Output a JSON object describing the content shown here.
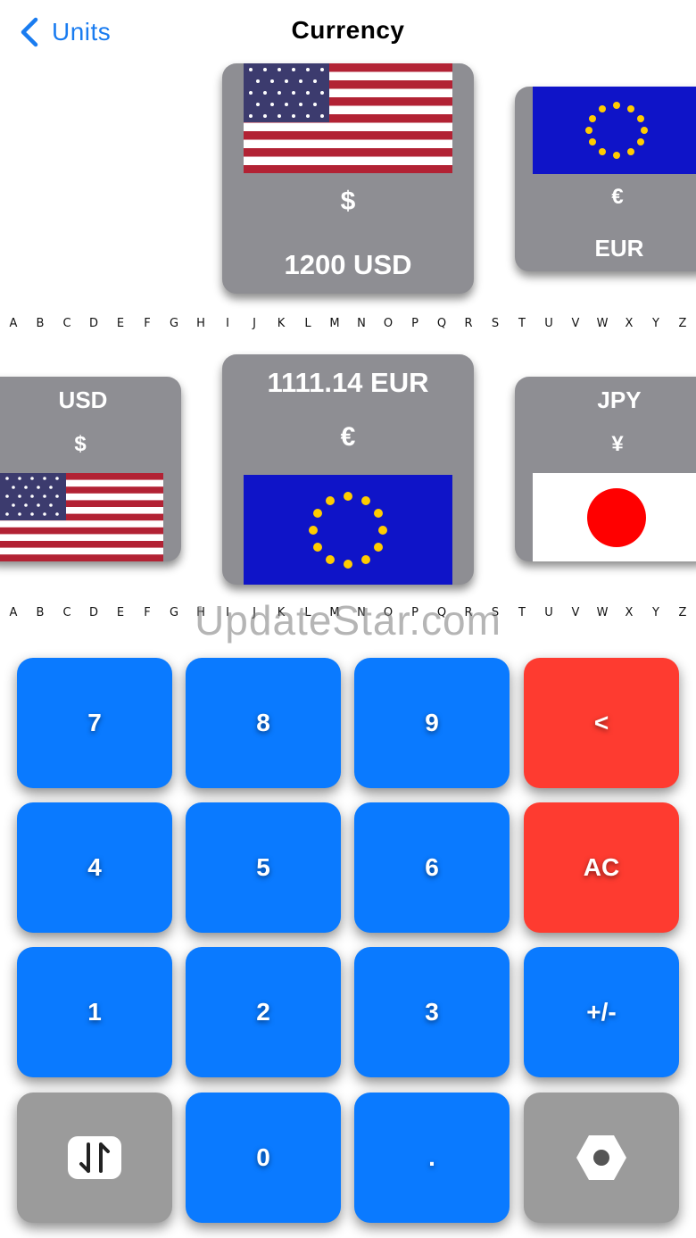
{
  "nav": {
    "back_label": "Units",
    "title": "Currency"
  },
  "top_row": {
    "center": {
      "symbol": "$",
      "value": "1200 USD",
      "flag": "us-flag"
    },
    "right": {
      "symbol": "€",
      "code": "EUR",
      "flag": "eu-flag"
    }
  },
  "bottom_row": {
    "left": {
      "code": "USD",
      "symbol": "$",
      "flag": "us-flag"
    },
    "center": {
      "value": "1111.14 EUR",
      "symbol": "€",
      "flag": "eu-flag"
    },
    "right": {
      "code": "JPY",
      "symbol": "¥",
      "flag": "jp-flag"
    }
  },
  "alphabet": [
    "A",
    "B",
    "C",
    "D",
    "E",
    "F",
    "G",
    "H",
    "I",
    "J",
    "K",
    "L",
    "M",
    "N",
    "O",
    "P",
    "Q",
    "R",
    "S",
    "T",
    "U",
    "V",
    "W",
    "X",
    "Y",
    "Z"
  ],
  "watermark": "UpdateStar.com",
  "keypad": {
    "k7": "7",
    "k8": "8",
    "k9": "9",
    "backspace": "<",
    "k4": "4",
    "k5": "5",
    "k6": "6",
    "clear": "AC",
    "k1": "1",
    "k2": "2",
    "k3": "3",
    "sign": "+/-",
    "k0": "0",
    "dot": ".",
    "swap_icon": "swap-icon",
    "settings_icon": "settings-icon"
  },
  "colors": {
    "accent": "#0a7aff",
    "danger": "#fe3b30",
    "card": "#8e8e93",
    "function_key": "#9b9b9b"
  }
}
